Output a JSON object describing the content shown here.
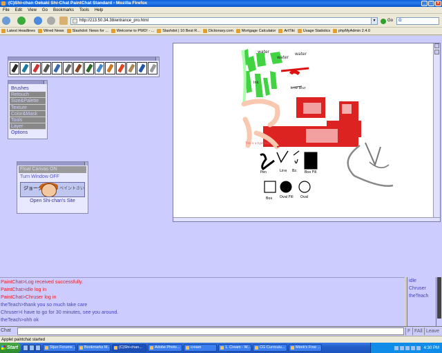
{
  "window": {
    "title": "(C)Shi-chan Oekaki Shi-Chat PaintChat Standard - Mozilla Firefox"
  },
  "menu": [
    "File",
    "Edit",
    "View",
    "Go",
    "Bookmarks",
    "Tools",
    "Help"
  ],
  "nav": {
    "url": "http://213.50.34.38/entrance_pro.html",
    "go_label": "Go",
    "search_value": ""
  },
  "bookmarks": [
    "Latest Headlines",
    "Wired News",
    "Slashdot: News for ...",
    "Welcome to PWD! - ...",
    "Slashdot | 10 Best R...",
    "Dictionary.com",
    "Mortgage Calculator",
    "ArtTiki",
    "Usage Statistics",
    "phpMyAdmin 2.4.0"
  ],
  "paint": {
    "brushes_title": "Brushes",
    "menu_items": [
      "Brushes",
      "Retouch",
      "Size&Palette",
      "Texture",
      "Color&Mask",
      "Tools",
      "Layer",
      "Options"
    ],
    "menu_active": [
      false,
      true,
      true,
      true,
      true,
      true,
      true,
      false
    ],
    "options_title": "Options",
    "options_items": [
      "Float Canvas ON",
      "Turn Window OFF"
    ],
    "banner_text_jp": "ジョーク",
    "banner_text_jp2": "ベイントさい",
    "site_link": "Open Shi-chan's Site",
    "canvas_texts": {
      "w1": "water",
      "w2": "water",
      "w3": "water",
      "a1": "Ink",
      "a2": "Lnw Blur",
      "smtext": "This is a type test",
      "l1": "Pen",
      "l2": "Line",
      "l3": "Bz.",
      "l4": "Box Fill",
      "l5": "Box",
      "l6": "Oval Fill",
      "l7": "Oval"
    }
  },
  "chat": {
    "lines": [
      {
        "text": "PaintChat>Log received successfully.",
        "kind": "sys"
      },
      {
        "text": "PaintChat>idle log in",
        "kind": "sys"
      },
      {
        "text": "PaintChat>Chruser log in",
        "kind": "sys"
      },
      {
        "text": "theTeach>thank you so much take care",
        "kind": "usr"
      },
      {
        "text": "Chruser>I have to go for 30 minutes, see you around.",
        "kind": "usr"
      },
      {
        "text": "theTeach>ohh ok",
        "kind": "usr"
      }
    ],
    "users": [
      "idle",
      "Chruser",
      "theTeach"
    ],
    "input_label": "Chat",
    "input_value": "",
    "btn_f": "F",
    "btn_fall": "FAll",
    "btn_leave": "Leave"
  },
  "status": "Applet paintchat started",
  "taskbar": {
    "start_label": "Start",
    "tasks": [
      "Stjun Forums ...",
      "Bookmarks M...",
      "(C)Shi-chan...",
      "Adobe Photo...",
      "cream",
      "1. Cream - W...",
      "CG Curriculu...",
      "Mirek's Free ..."
    ],
    "active_index": 2,
    "clock": "4:30 PM"
  }
}
